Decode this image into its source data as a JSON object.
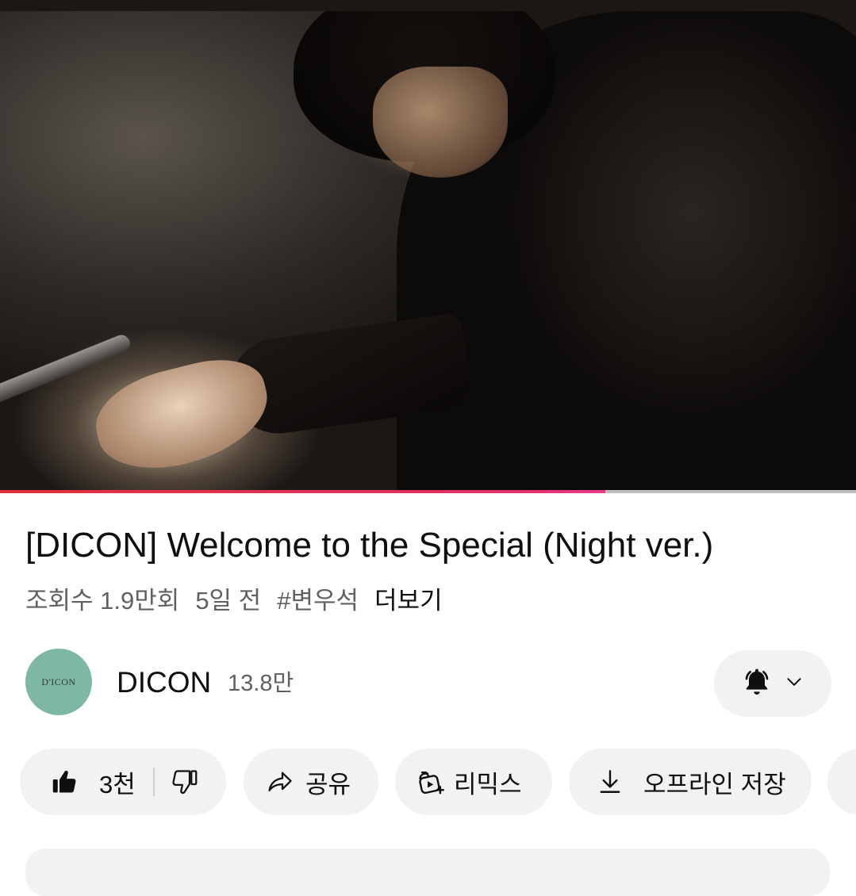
{
  "video": {
    "progress_fraction": 0.707,
    "progress_color": "#e0303a"
  },
  "title": "[DICON] Welcome to the Special (Night ver.)",
  "meta": {
    "views": "조회수 1.9만회",
    "age": "5일 전",
    "hashtag": "#변우석",
    "more": "더보기"
  },
  "channel": {
    "avatar_text": "D'ICON",
    "avatar_color": "#7fb7a7",
    "name": "DICON",
    "subscribers": "13.8만",
    "bell_icon": "bell-filled-icon",
    "dropdown_icon": "chevron-down-icon"
  },
  "actions": {
    "like_count": "3천",
    "like_icon": "thumbs-up-filled-icon",
    "dislike_icon": "thumbs-down-icon",
    "share_label": "공유",
    "share_icon": "share-arrow-icon",
    "remix_label": "리믹스",
    "remix_icon": "remix-icon",
    "offline_label": "오프라인 저장",
    "offline_icon": "download-icon",
    "extra_icon": "save-icon"
  }
}
